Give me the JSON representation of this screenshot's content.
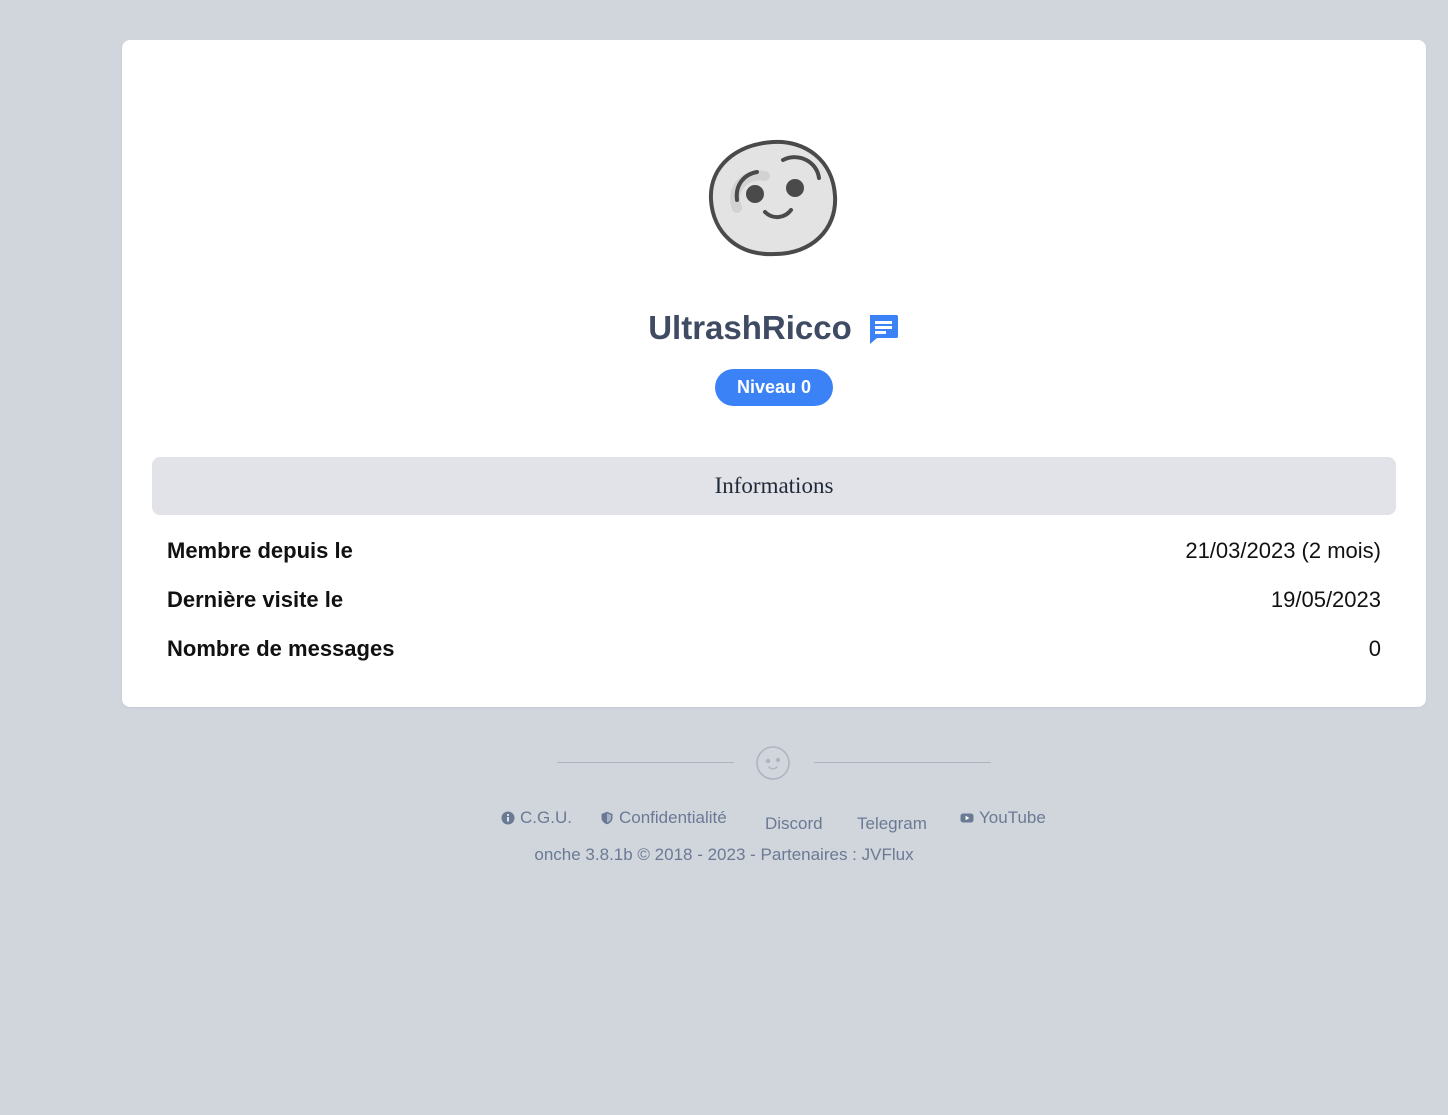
{
  "profile": {
    "username": "UltrashRicco",
    "level_badge": "Niveau 0",
    "avatar_icon": "smiley-face-icon",
    "message_icon": "message-icon",
    "accent_color": "#3b82f6"
  },
  "info": {
    "header": "Informations",
    "rows": [
      {
        "label": "Membre depuis le",
        "value": "21/03/2023 (2 mois)"
      },
      {
        "label": "Dernière visite le",
        "value": "19/05/2023"
      },
      {
        "label": "Nombre de messages",
        "value": "0"
      }
    ]
  },
  "footer": {
    "links": {
      "cgu": "C.G.U.",
      "confidentialite": "Confidentialité",
      "discord": "Discord",
      "telegram": "Telegram",
      "youtube": "YouTube"
    },
    "copyright": "onche 3.8.1b © 2018 - 2023 - Partenaires : JVFlux"
  }
}
